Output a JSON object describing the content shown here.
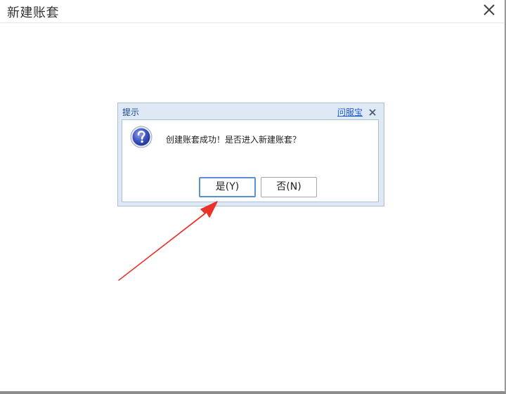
{
  "window": {
    "title": "新建账套",
    "close_icon": "close-icon"
  },
  "dialog": {
    "title": "提示",
    "help_link": "问服宝",
    "close_icon": "close-icon",
    "icon": "question-icon",
    "message": "创建账套成功！是否进入新建账套？",
    "buttons": {
      "yes": "是(Y)",
      "no": "否(N)"
    }
  },
  "annotation": {
    "icon": "red-arrow",
    "color": "#e8322a"
  },
  "colors": {
    "dialog_frame": "#dfe9f5",
    "dialog_title": "#15428b",
    "link": "#1f5bd6",
    "default_button_border": "#5b8fd6"
  }
}
